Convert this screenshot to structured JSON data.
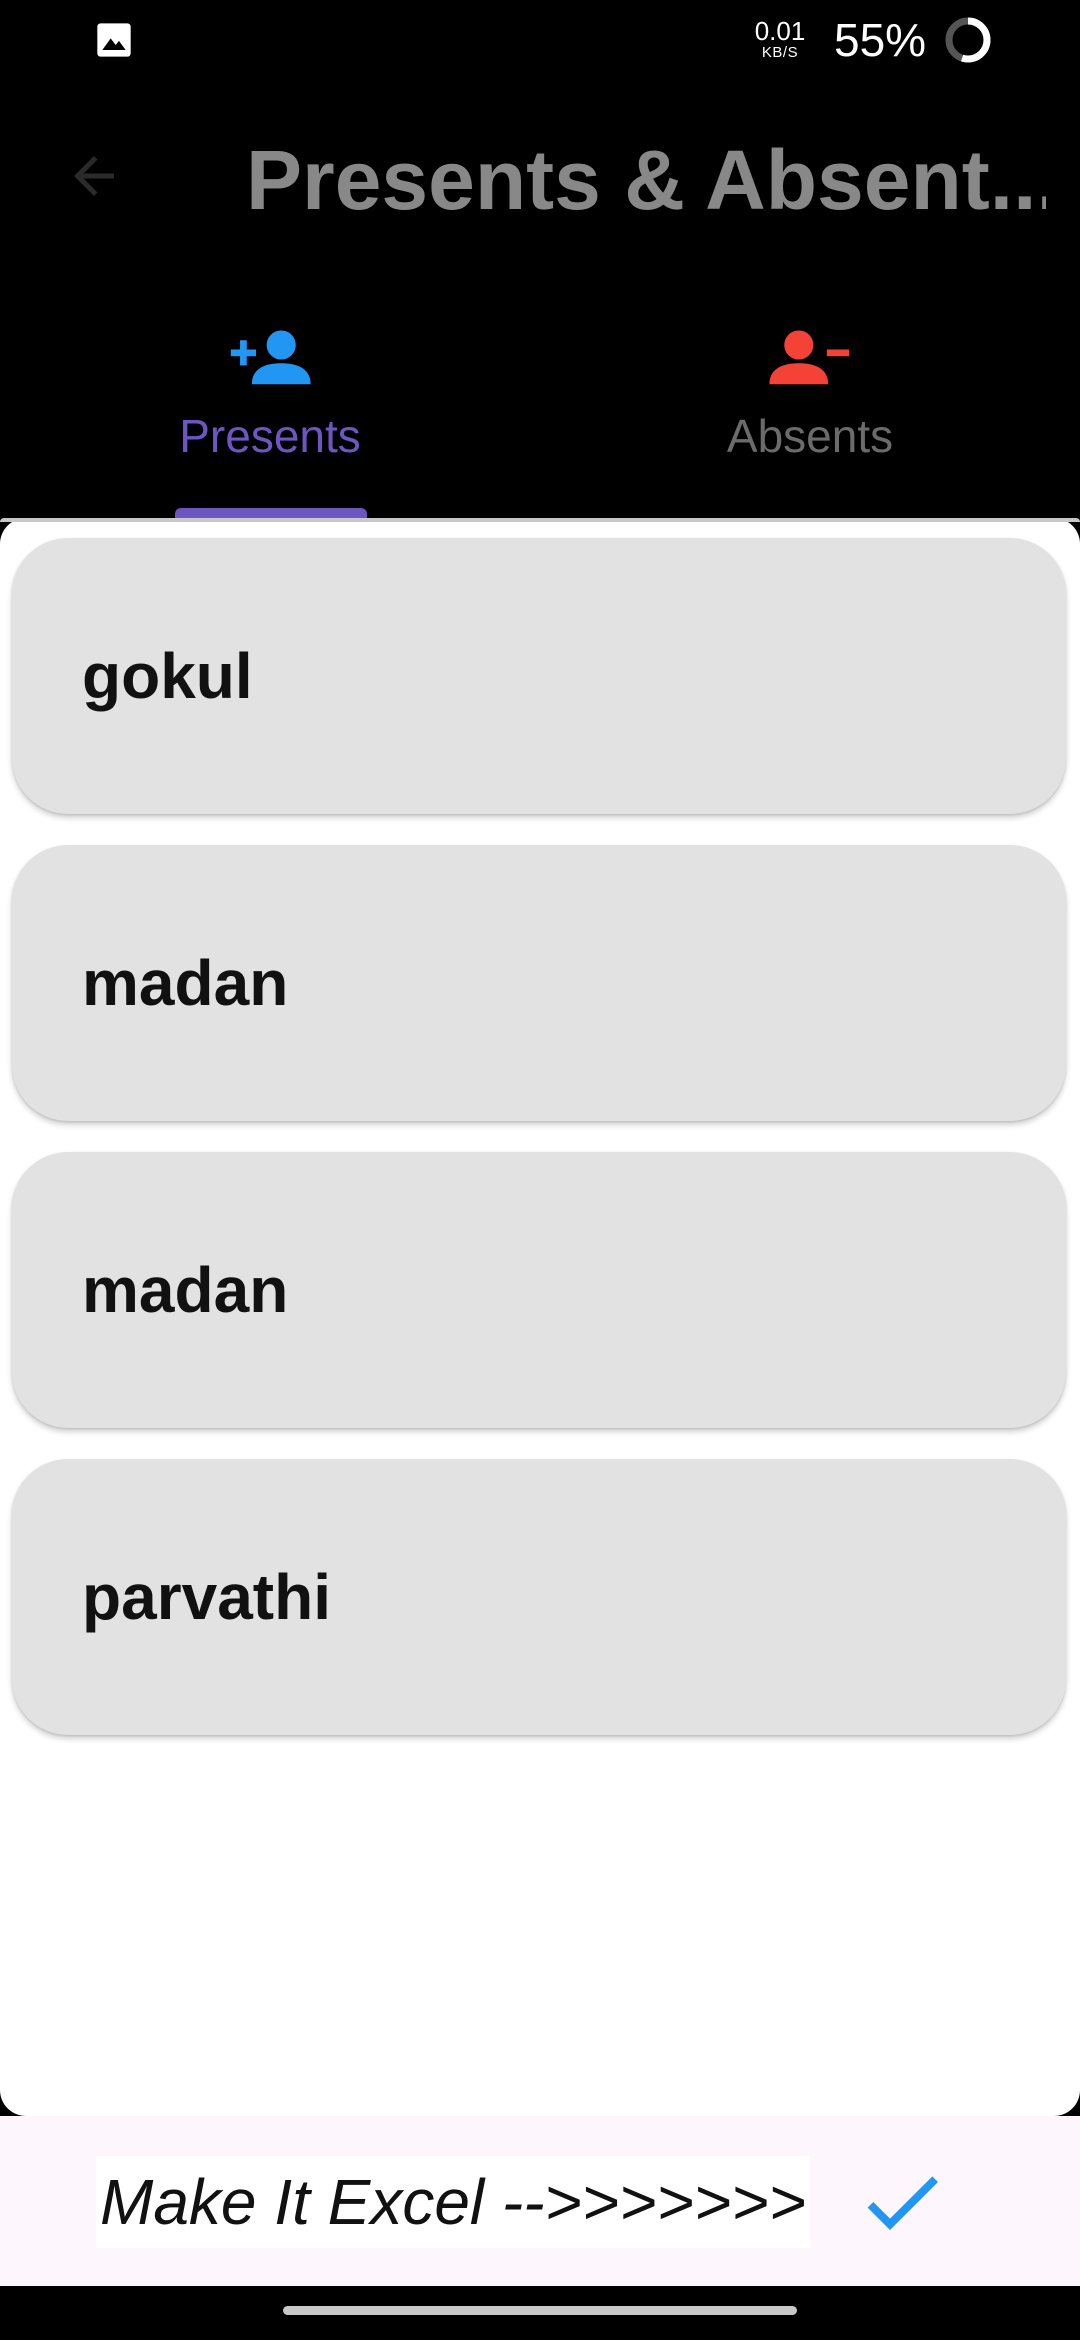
{
  "status_bar": {
    "speed_value": "0.01",
    "speed_unit": "KB/S",
    "battery": "55%"
  },
  "app_bar": {
    "title": "Presents & Absent..."
  },
  "tabs": [
    {
      "label": "Presents",
      "icon": "person-add-icon",
      "color": "#2196f3",
      "selected": true
    },
    {
      "label": "Absents",
      "icon": "person-remove-icon",
      "color": "#f44336",
      "selected": false
    }
  ],
  "accent_color": "#6e56c2",
  "students": [
    {
      "name": "gokul"
    },
    {
      "name": "madan"
    },
    {
      "name": "madan"
    },
    {
      "name": "parvathi"
    }
  ],
  "bottom_bar": {
    "label": "Make It Excel -->>>>>>>",
    "action_icon": "check-icon"
  }
}
